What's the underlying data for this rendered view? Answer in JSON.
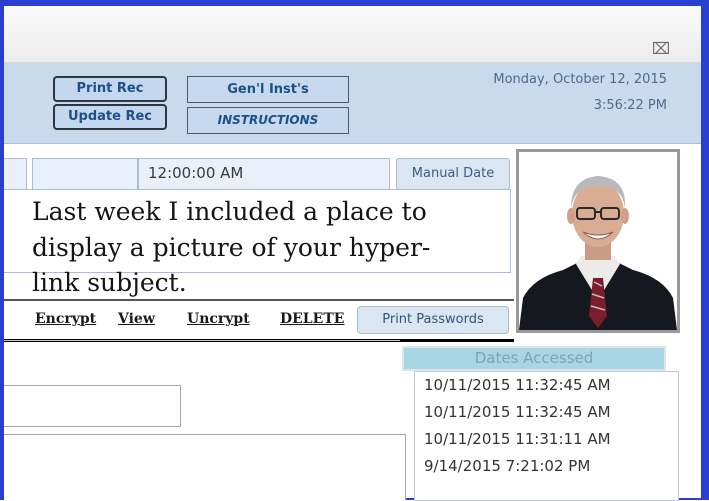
{
  "window": {
    "close_glyph": "⌧"
  },
  "header": {
    "buttons": {
      "print_rec": "Print Rec",
      "update_rec": "Update Rec",
      "gen_inst": "Gen'l Inst's",
      "instructions": "INSTRUCTIONS"
    },
    "date_line": "Monday, October 12, 2015",
    "time_line": "3:56:22 PM"
  },
  "record": {
    "time_value": "12:00:00 AM",
    "manual_date_label": "Manual Date"
  },
  "note": {
    "lines": [
      "Last week I included a place to",
      "display a picture of your hyper-",
      "link subject."
    ]
  },
  "commands": {
    "encrypt": "Encrypt",
    "view": "View",
    "uncrypt": "Uncrypt",
    "delete": "DELETE",
    "print_passwords": "Print Passwords"
  },
  "dates_accessed": {
    "title": "Dates Accessed",
    "items": [
      "10/11/2015 11:32:45 AM",
      "10/11/2015 11:32:45 AM",
      "10/11/2015 11:31:11 AM",
      "9/14/2015 7:21:02 PM"
    ]
  },
  "colors": {
    "window_border": "#2a3fcf",
    "header_bg": "#c8daec",
    "button_bg": "#c3d7ee",
    "button_text": "#1f4f86",
    "dates_header_bg": "#a8d5e2"
  }
}
